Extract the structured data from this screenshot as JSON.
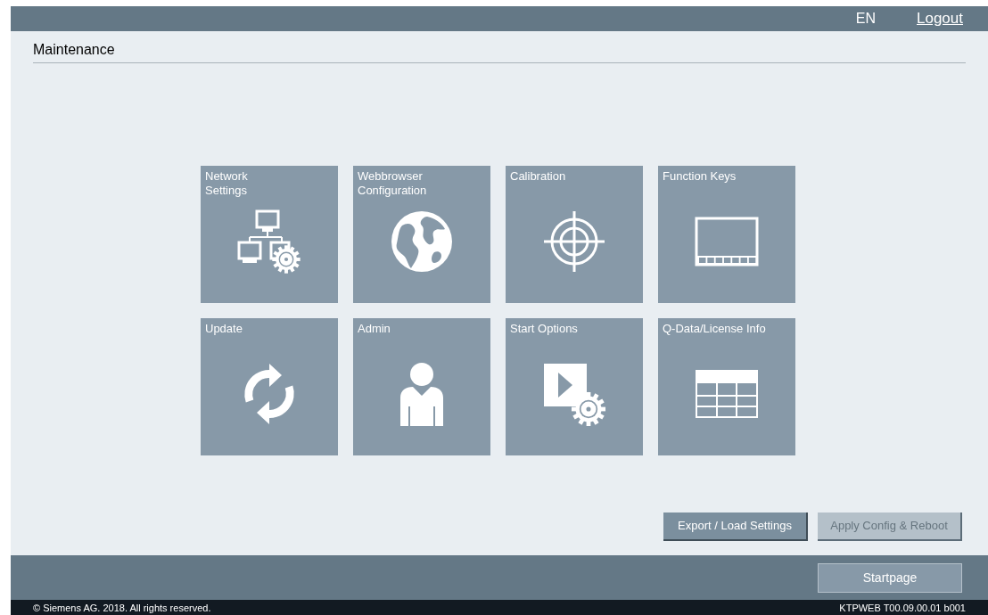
{
  "header": {
    "language": "EN",
    "logout": "Logout"
  },
  "page_title": "Maintenance",
  "tiles": [
    {
      "label": "Network\nSettings",
      "kind": "network"
    },
    {
      "label": "Webbrowser\nConfiguration",
      "kind": "globe"
    },
    {
      "label": "Calibration",
      "kind": "target"
    },
    {
      "label": "Function Keys",
      "kind": "keys"
    },
    {
      "label": "Update",
      "kind": "refresh"
    },
    {
      "label": "Admin",
      "kind": "person"
    },
    {
      "label": "Start Options",
      "kind": "play"
    },
    {
      "label": "Q-Data/License Info",
      "kind": "table"
    }
  ],
  "actions": [
    {
      "label": "Export / Load Settings",
      "disabled": false
    },
    {
      "label": "Apply Config & Reboot",
      "disabled": true
    }
  ],
  "footer": {
    "startpage": "Startpage",
    "copyright": "© Siemens AG. 2018. All rights reserved.",
    "version": "KTPWEB T00.09.00.01 b001"
  }
}
